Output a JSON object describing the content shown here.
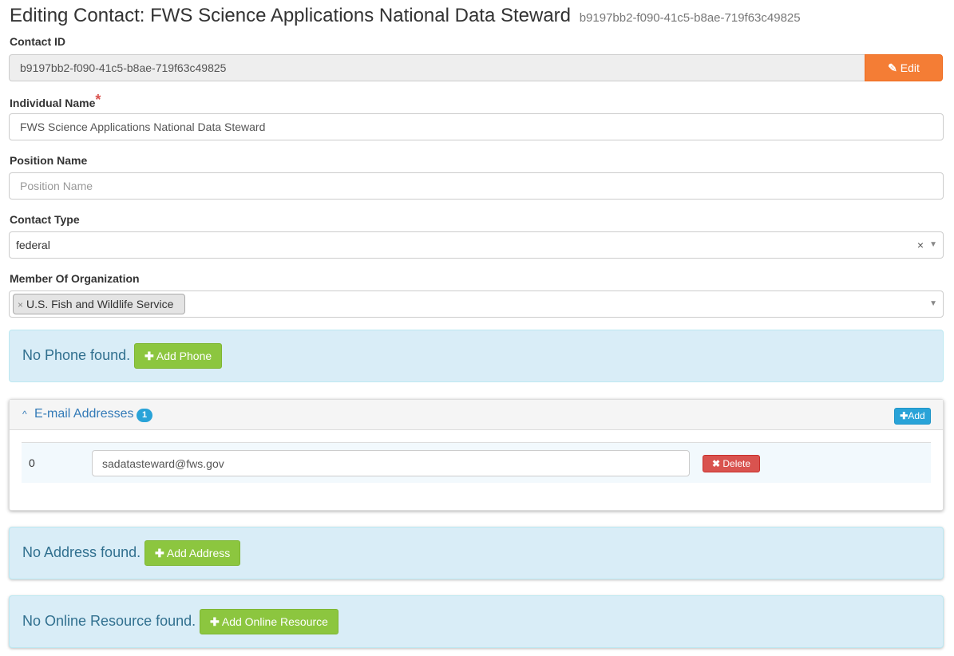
{
  "header": {
    "title": "Editing Contact: FWS Science Applications National Data Steward",
    "subtitle": "b9197bb2-f090-41c5-b8ae-719f63c49825"
  },
  "contact_id": {
    "label": "Contact ID",
    "value": "b9197bb2-f090-41c5-b8ae-719f63c49825",
    "edit_label": "Edit"
  },
  "individual_name": {
    "label": "Individual Name",
    "required_mark": "*",
    "value": "FWS Science Applications National Data Steward"
  },
  "position_name": {
    "label": "Position Name",
    "value": "",
    "placeholder": "Position Name"
  },
  "contact_type": {
    "label": "Contact Type",
    "value": "federal",
    "clear_glyph": "×",
    "caret_glyph": "▼"
  },
  "member_of": {
    "label": "Member Of Organization",
    "tag_remove_glyph": "×",
    "tags": [
      "U.S. Fish and Wildlife Service"
    ],
    "caret_glyph": "▼"
  },
  "phone": {
    "message": "No Phone found.",
    "button_label": "Add Phone"
  },
  "email": {
    "title": "E-mail Addresses",
    "count": "1",
    "add_label": "Add",
    "rows": [
      {
        "index": "0",
        "value": "sadatasteward@fws.gov",
        "delete_label": "Delete"
      }
    ]
  },
  "address": {
    "message": "No Address found.",
    "button_label": "Add Address"
  },
  "online_resource": {
    "message": "No Online Resource found.",
    "button_label": "Add Online Resource"
  },
  "icons": {
    "plus": "✚",
    "pencil": "✎",
    "times": "✖",
    "chevron_up": "^"
  },
  "colors": {
    "edit_orange": "#f47d35",
    "add_green": "#8cc63f",
    "info_blue_bg": "#d9edf7",
    "info_text": "#31708f",
    "delete_red": "#d9534f",
    "badge_blue": "#29a3d8"
  }
}
